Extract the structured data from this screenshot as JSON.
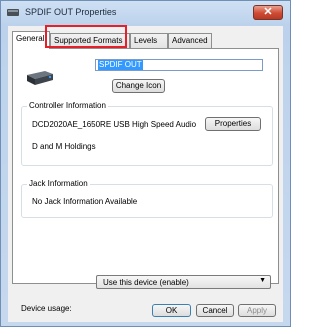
{
  "window": {
    "title": "SPDIF OUT Properties"
  },
  "tabs": [
    "General",
    "Supported Formats",
    "Levels",
    "Advanced"
  ],
  "general": {
    "device_name": "SPDIF OUT",
    "change_icon_label": "Change Icon",
    "controller": {
      "label": "Controller Information",
      "name": "DCD2020AE_1650RE USB High Speed Audio",
      "vendor": "D and M Holdings",
      "properties_label": "Properties"
    },
    "jack": {
      "label": "Jack Information",
      "text": "No Jack Information Available"
    },
    "device_usage": {
      "label": "Device usage:",
      "value": "Use this device (enable)"
    }
  },
  "buttons": {
    "ok": "OK",
    "cancel": "Cancel",
    "apply": "Apply"
  },
  "colors": {
    "highlight": "#e4202a",
    "selection": "#3399ff"
  }
}
